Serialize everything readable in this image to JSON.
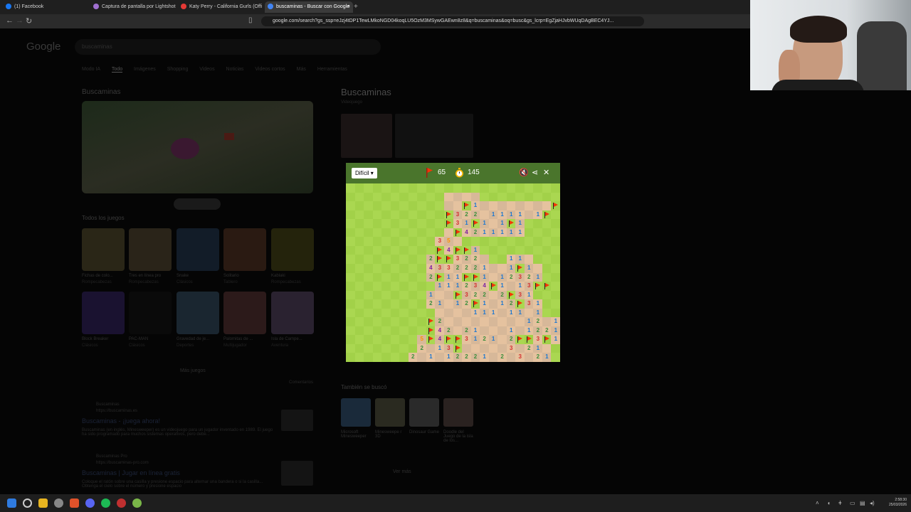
{
  "browser": {
    "tabs": [
      {
        "label": "(1) Facebook",
        "icon_color": "#1877f2"
      },
      {
        "label": "Captura de pantalla por Lightshot",
        "icon_color": "#a070d0"
      },
      {
        "label": "Katy Perry - California Gurls (Offi",
        "icon_color": "#e53935"
      },
      {
        "label": "buscaminas - Buscar con Google",
        "icon_color": "#4285f4"
      }
    ],
    "active_tab": 3,
    "new_tab_label": "+",
    "close_label": "×",
    "url": "google.com/search?gs_ssp=eJzj4tDP1TewLMkoNGD04koqLU5OzM3MSywGAEwn8z8&q=buscaminas&oq=busc&gs_lcrp=EgZjaHJvbWUqDAgBEC4YJ..."
  },
  "google": {
    "logo": "Google",
    "search_value": "buscaminas",
    "filters": [
      "Modo IA",
      "Todo",
      "Imágenes",
      "Shopping",
      "Videos",
      "Noticias",
      "Videos cortos",
      "Más",
      "Herramientas"
    ],
    "active_filter": "Todo",
    "left_title": "Buscaminas",
    "play_button": "Jugar",
    "all_games_heading": "Todos los juegos",
    "games": [
      {
        "title": "Fichas de colo...",
        "sub": "Rompecabezas",
        "color": "#2a2617"
      },
      {
        "title": "Tres en línea pro",
        "sub": "Rompecabezas",
        "color": "#2a2419"
      },
      {
        "title": "Snake",
        "sub": "Clásicos",
        "color": "#121c28"
      },
      {
        "title": "Solitario",
        "sub": "Tablero",
        "color": "#2a1a12"
      },
      {
        "title": "Kablaki",
        "sub": "Rompecabezas",
        "color": "#24230c"
      },
      {
        "title": "Block Breaker",
        "sub": "Clásicos",
        "color": "#1a1230"
      },
      {
        "title": "PAC-MAN",
        "sub": "Clásicos",
        "color": "#0a0a0a"
      },
      {
        "title": "Gravedad de je...",
        "sub": "Deportes",
        "color": "#1a2630"
      },
      {
        "title": "Palomitas de ...",
        "sub": "Multijugador",
        "color": "#2c1a1a"
      },
      {
        "title": "Isla de Campe...",
        "sub": "Aventura",
        "color": "#2a2230"
      }
    ],
    "more_games": "Más juegos",
    "comments": "Comentarios",
    "results": [
      {
        "site": "Buscaminas",
        "url": "https://buscaminas.es",
        "title": "Buscaminas - ¡juega ahora!",
        "snippet": "Buscaminas (en inglés, Minesweeper) es un videojuego para un jugador inventado en 1989. El juego ha sido programado para muchos sistemas operativos, pero debe..."
      },
      {
        "site": "Buscaminas Pro",
        "url": "https://buscaminas-pro.com",
        "title": "Buscaminas | Jugar en línea gratis",
        "snippet": "Coloque el ratón sobre una casilla y presione espacio para alternar una bandera o si la casilla... Obtenga el cielo sobre el número y presione espacio"
      }
    ],
    "right_title": "Buscaminas",
    "right_subtitle": "Videojuego",
    "also_searched": "También se buscó",
    "related": [
      {
        "title": "Microsoft Minesweeper",
        "color": "#1a2a3a"
      },
      {
        "title": "Minesweepe r 3D",
        "color": "#2a2a20"
      },
      {
        "title": "Dinosaur Game",
        "color": "#2a2a2a"
      },
      {
        "title": "Doodle del Juego de la isla de los...",
        "color": "#2a2220"
      }
    ],
    "see_more": "Ver más"
  },
  "game": {
    "difficulty": "Difícil",
    "flags_left": "65",
    "timer": "145",
    "colors": {
      "header": "#4a752c",
      "light_green": "#aad751",
      "dark_green": "#a2d149",
      "light_sand": "#e5c29f",
      "dark_sand": "#d7b899",
      "flag": "#f23607"
    },
    "number_colors": {
      "1": "#1976d2",
      "2": "#388e3c",
      "3": "#d32f2f",
      "4": "#7b1fa2",
      "5": "#ff8f00"
    },
    "board": {
      "cols": 24,
      "rows": 20,
      "grid": [
        "........................",
        "...........    .........",
        "...........  F1        F",
        "...........F322 1111 1F.",
        "...........F31F1 1F1....",
        "........... F4211111....",
        "..........35 ...........",
        "..........F4FF1.........",
        ".........2FF322 ..11 ...",
        ".........4332221  1F1 ..",
        ".........2F11FF1 12321..",
        "..........111234F1 13FF.",
        ".........1  F322 2F31...",
        ".........21 12F1 12F31..",
        "..........    111 11 1..",
        ".........F2         12 1",
        ".........F42 21   1 1221",
        "........5F4FF3121 2FF3F1",
        "........2 13F     3 21 .",
        ".......2 1 12221 2 3 21."
      ]
    }
  },
  "windows": {
    "time": "2:58:30",
    "date": "25/03/2026"
  }
}
